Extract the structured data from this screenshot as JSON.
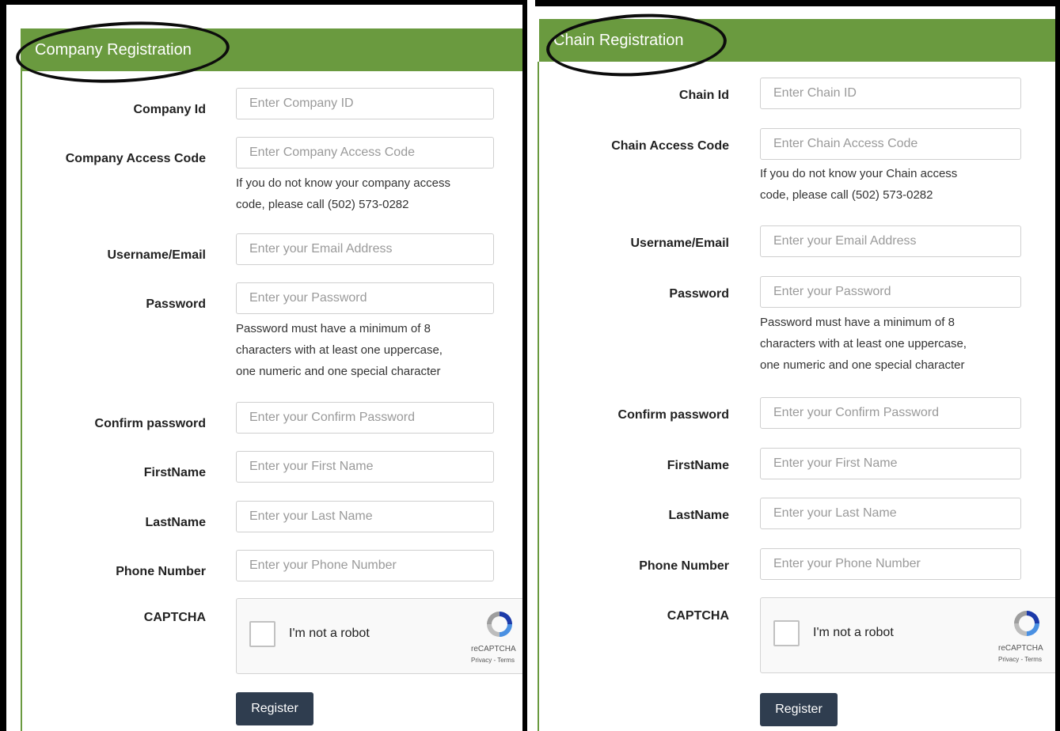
{
  "company": {
    "title": "Company Registration",
    "fields": [
      {
        "label": "Company Id",
        "placeholder": "Enter Company ID"
      },
      {
        "label": "Company Access Code",
        "placeholder": "Enter Company Access Code"
      },
      {
        "label": "Username/Email",
        "placeholder": "Enter your Email Address"
      },
      {
        "label": "Password",
        "placeholder": "Enter your Password"
      },
      {
        "label": "Confirm password",
        "placeholder": "Enter your Confirm Password"
      },
      {
        "label": "FirstName",
        "placeholder": "Enter your First Name"
      },
      {
        "label": "LastName",
        "placeholder": "Enter your Last Name"
      },
      {
        "label": "Phone Number",
        "placeholder": "Enter your Phone Number"
      }
    ],
    "access_help": [
      "If you do not know your company access",
      "code, please call (502) 573-0282"
    ],
    "password_help": [
      "Password must have a minimum of 8",
      "characters with at least one uppercase,",
      "one numeric and one special character"
    ],
    "captcha_label": "CAPTCHA",
    "captcha_text": "I'm not a robot",
    "recaptcha_brand": "reCAPTCHA",
    "recaptcha_links": "Privacy - Terms",
    "register_label": "Register"
  },
  "chain": {
    "title": "Chain Registration",
    "fields": [
      {
        "label": "Chain Id",
        "placeholder": "Enter Chain ID"
      },
      {
        "label": "Chain Access Code",
        "placeholder": "Enter Chain Access Code"
      },
      {
        "label": "Username/Email",
        "placeholder": "Enter your Email Address"
      },
      {
        "label": "Password",
        "placeholder": "Enter your Password"
      },
      {
        "label": "Confirm password",
        "placeholder": "Enter your Confirm Password"
      },
      {
        "label": "FirstName",
        "placeholder": "Enter your First Name"
      },
      {
        "label": "LastName",
        "placeholder": "Enter your Last Name"
      },
      {
        "label": "Phone Number",
        "placeholder": "Enter your Phone Number"
      }
    ],
    "access_help": [
      "If you do not know your Chain access",
      "code, please call (502) 573-0282"
    ],
    "password_help": [
      "Password must have a minimum of 8",
      "characters with at least one uppercase,",
      "one numeric and one special character"
    ],
    "captcha_label": "CAPTCHA",
    "captcha_text": "I'm not a robot",
    "recaptcha_brand": "reCAPTCHA",
    "recaptcha_links": "Privacy - Terms",
    "register_label": "Register"
  },
  "colors": {
    "header_green": "#6a9a3f",
    "button_navy": "#2f3d4f"
  }
}
